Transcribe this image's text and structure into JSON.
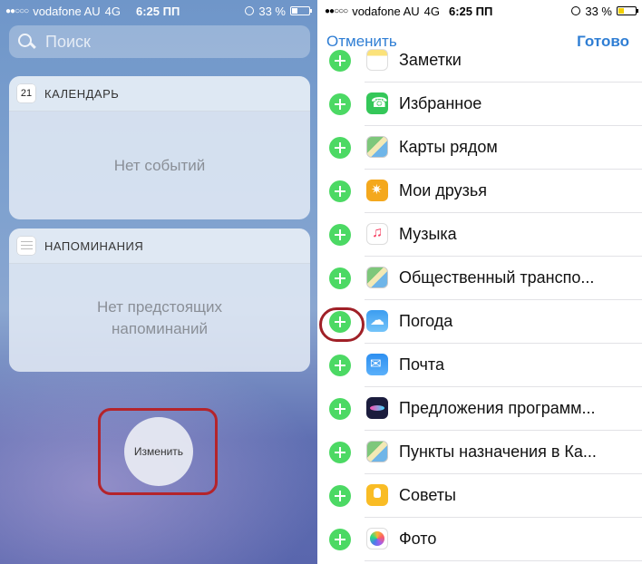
{
  "left": {
    "status": {
      "carrier": "vodafone AU",
      "network": "4G",
      "time": "6:25 ПП",
      "battery": "33 %"
    },
    "search": {
      "placeholder": "Поиск"
    },
    "calendar_widget": {
      "title": "КАЛЕНДАРЬ",
      "icon_day": "21",
      "message": "Нет событий"
    },
    "reminders_widget": {
      "title": "НАПОМИНАНИЯ",
      "message_line1": "Нет предстоящих",
      "message_line2": "напоминаний"
    },
    "edit_button": {
      "label": "Изменить"
    }
  },
  "right": {
    "status": {
      "carrier": "vodafone AU",
      "network": "4G",
      "time": "6:25 ПП",
      "battery": "33 %"
    },
    "nav": {
      "cancel_label": "Отменить",
      "done_label": "Готово"
    },
    "items": [
      {
        "label": "Заметки",
        "icon": "notes-icon"
      },
      {
        "label": "Избранное",
        "icon": "phone-icon"
      },
      {
        "label": "Карты рядом",
        "icon": "maps-icon"
      },
      {
        "label": "Мои друзья",
        "icon": "friends-icon"
      },
      {
        "label": "Музыка",
        "icon": "music-icon"
      },
      {
        "label": "Общественный транспо...",
        "icon": "maps-icon"
      },
      {
        "label": "Погода",
        "icon": "weather-icon"
      },
      {
        "label": "Почта",
        "icon": "mail-icon"
      },
      {
        "label": "Предложения программ...",
        "icon": "siri-icon"
      },
      {
        "label": "Пункты назначения в Ка...",
        "icon": "maps-icon"
      },
      {
        "label": "Советы",
        "icon": "tips-icon"
      },
      {
        "label": "Фото",
        "icon": "photos-icon"
      }
    ]
  },
  "colors": {
    "accent_blue": "#2f7ed4",
    "add_green": "#4cd964",
    "highlight_red": "#b4242b"
  }
}
